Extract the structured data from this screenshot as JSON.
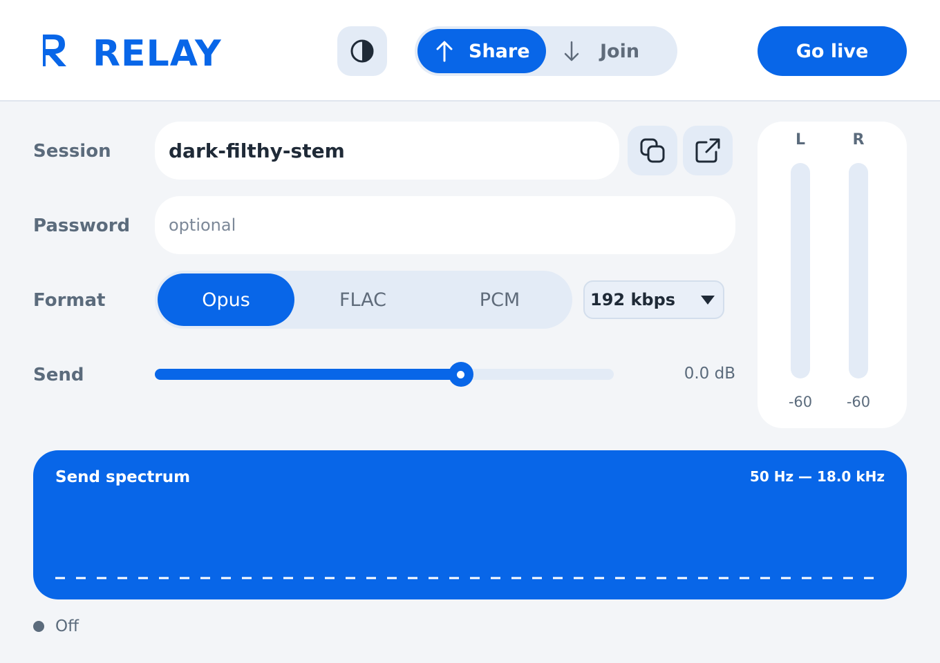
{
  "header": {
    "app_name": "RELAY",
    "logo_icon": "relay-logo-icon",
    "theme_icon": "contrast-icon",
    "mode_switch": [
      {
        "label": "Share",
        "icon": "arrow-up-icon",
        "active": true
      },
      {
        "label": "Join",
        "icon": "arrow-down-icon",
        "active": false
      }
    ],
    "primary_action": "Go live"
  },
  "form": {
    "session": {
      "label": "Session",
      "value": "dark-filthy-stem",
      "copy_icon": "copy-icon",
      "open_icon": "external-link-icon"
    },
    "password": {
      "label": "Password",
      "value": "",
      "placeholder": "optional"
    },
    "format": {
      "label": "Format",
      "options": [
        "Opus",
        "FLAC",
        "PCM"
      ],
      "selected": "Opus",
      "bitrate": "192 kbps"
    },
    "send": {
      "label": "Send",
      "value_text": "0.0 dB",
      "level_fraction": 0.667
    }
  },
  "meters": {
    "channels": [
      {
        "label": "L",
        "db": "-60",
        "level_fraction": 0
      },
      {
        "label": "R",
        "db": "-60",
        "level_fraction": 0
      }
    ]
  },
  "spectrum": {
    "title": "Send spectrum",
    "range": "50 Hz — 18.0 kHz"
  },
  "status": {
    "text": "Off"
  },
  "colors": {
    "accent": "#0866e8",
    "background": "#f3f5f8",
    "muted_text": "#5b6b7c",
    "control_bg": "#e3ebf6"
  }
}
